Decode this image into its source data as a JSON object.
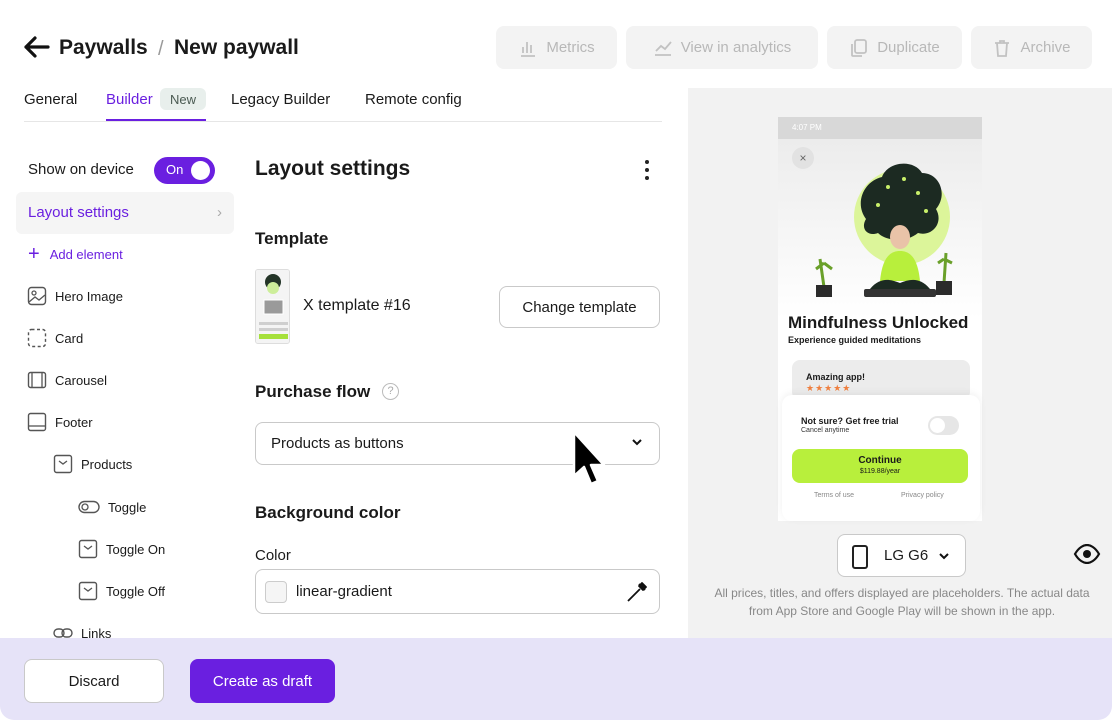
{
  "header": {
    "breadcrumb_parent": "Paywalls",
    "breadcrumb_separator": "/",
    "breadcrumb_current": "New paywall",
    "actions": {
      "metrics": "Metrics",
      "analytics": "View in analytics",
      "duplicate": "Duplicate",
      "archive": "Archive"
    }
  },
  "tabs": {
    "general": "General",
    "builder": "Builder",
    "builder_badge": "New",
    "legacy": "Legacy Builder",
    "remote": "Remote config"
  },
  "sidebar": {
    "show_on_device": "Show on device",
    "toggle_state": "On",
    "layout_settings": "Layout settings",
    "add_element": "Add element",
    "tree": {
      "hero": "Hero Image",
      "card": "Card",
      "carousel": "Carousel",
      "footer": "Footer",
      "products": "Products",
      "toggle": "Toggle",
      "toggle_on": "Toggle On",
      "toggle_off": "Toggle Off",
      "links": "Links"
    }
  },
  "main": {
    "title": "Layout settings",
    "template_section": "Template",
    "template_name": "X template #16",
    "change_template": "Change template",
    "purchase_flow_section": "Purchase flow",
    "purchase_flow_value": "Products as buttons",
    "background_section": "Background color",
    "color_label": "Color",
    "color_value": "linear-gradient"
  },
  "preview": {
    "status_time": "4:07 PM",
    "close_glyph": "×",
    "title": "Mindfulness Unlocked",
    "subtitle": "Experience guided meditations",
    "review_title": "Amazing app!",
    "review_stars": "★★★★★",
    "trial_title": "Not sure? Get free trial",
    "trial_sub": "Cancel anytime",
    "cta_label": "Continue",
    "cta_price": "$119.88/year",
    "terms": "Terms of use",
    "privacy": "Privacy policy",
    "device": "LG G6",
    "note": "All prices, titles, and offers displayed are placeholders. The actual data from App Store and Google Play will be shown in the app."
  },
  "footer": {
    "discard": "Discard",
    "create": "Create as draft"
  },
  "colors": {
    "accent": "#6a1fe0",
    "cta_lime": "#b8ef3c",
    "bottom_bar": "#e6e3f8"
  }
}
